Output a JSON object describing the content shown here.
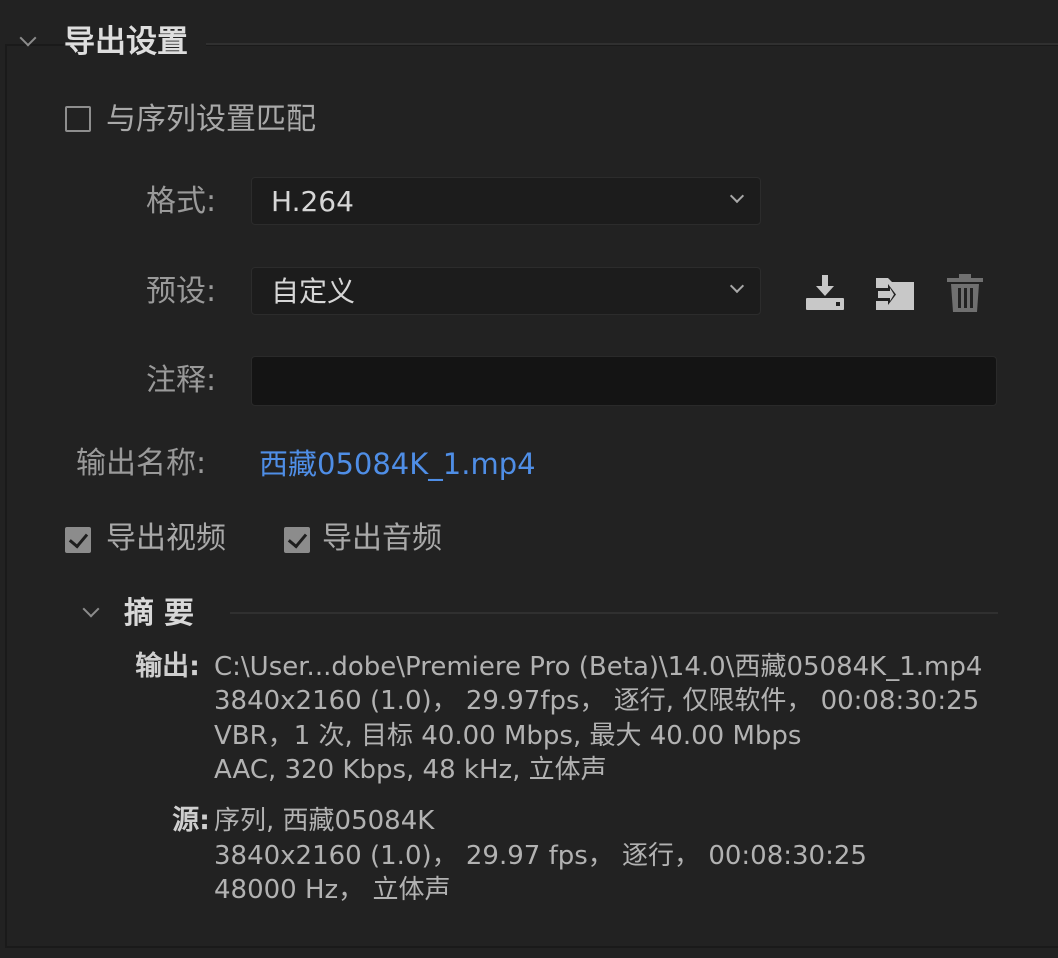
{
  "section": {
    "title": "导出设置"
  },
  "match_sequence": {
    "label": "与序列设置匹配",
    "checked": false
  },
  "format": {
    "label": "格式:",
    "value": "H.264"
  },
  "preset": {
    "label": "预设:",
    "value": "自定义",
    "icons": [
      "save-preset-icon",
      "import-preset-icon",
      "delete-preset-icon"
    ]
  },
  "comments": {
    "label": "注释:",
    "value": ""
  },
  "output_name": {
    "label": "输出名称:",
    "value": "西藏05084K_1.mp4"
  },
  "export_video": {
    "label": "导出视频",
    "checked": true
  },
  "export_audio": {
    "label": "导出音频",
    "checked": true
  },
  "summary": {
    "title": "摘要",
    "output_label": "输出:",
    "output_lines": [
      "C:\\User...dobe\\Premiere  Pro  (Beta)\\14.0\\西藏05084K_1.mp4",
      "3840x2160 (1.0)，  29.97fps，  逐行, 仅限软件，  00:08:30:25",
      "VBR，1 次, 目标 40.00 Mbps, 最大 40.00 Mbps",
      "AAC, 320 Kbps, 48  kHz, 立体声"
    ],
    "source_label": "源:",
    "source_lines": [
      "序列, 西藏05084K",
      "3840x2160 (1.0)，  29.97 fps，  逐行，  00:08:30:25",
      "48000 Hz，  立体声"
    ]
  },
  "colors": {
    "background": "#222222",
    "link": "#4f8ee6",
    "checkbox_checked": "#8c8c8c"
  }
}
